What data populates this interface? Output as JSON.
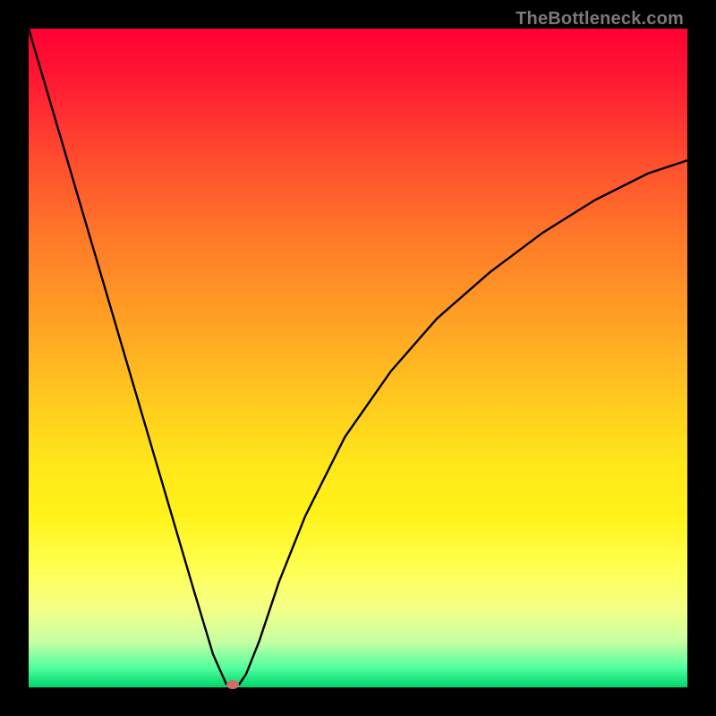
{
  "chart_data": {
    "type": "line",
    "title": "",
    "xlabel": "",
    "ylabel": "",
    "xlim": [
      0,
      100
    ],
    "ylim": [
      0,
      100
    ],
    "series": [
      {
        "name": "bottleneck-curve",
        "x": [
          0,
          5,
          10,
          15,
          20,
          25,
          28,
          30,
          31,
          32,
          33,
          35,
          38,
          42,
          48,
          55,
          62,
          70,
          78,
          86,
          94,
          100
        ],
        "y": [
          100,
          83,
          66,
          49,
          32,
          15,
          5,
          0.5,
          0,
          0.5,
          2,
          7,
          16,
          26,
          38,
          48,
          56,
          63,
          69,
          74,
          78,
          80
        ]
      }
    ],
    "marker": {
      "x": 31,
      "y": 0
    },
    "background_gradient": {
      "top": "#ff0033",
      "mid": "#ffcc1a",
      "bottom": "#00d46b"
    }
  },
  "watermark": {
    "text": "TheBottleneck.com"
  }
}
